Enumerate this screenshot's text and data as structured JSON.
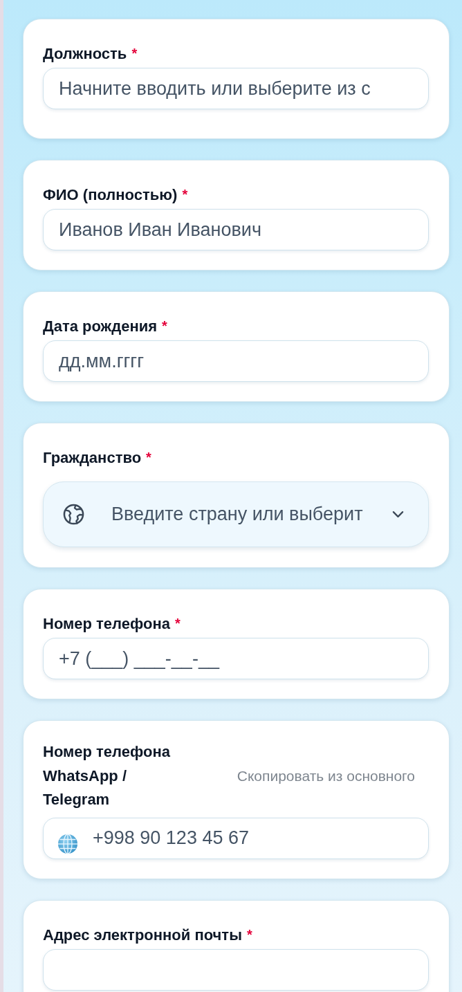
{
  "fields": [
    {
      "kind": "autocomplete",
      "label": "Должность",
      "required_mark": "*",
      "placeholder": "Начните вводить или выберите из с"
    },
    {
      "kind": "text",
      "label": "ФИО (полностью)",
      "required_mark": "*",
      "placeholder": "Иванов Иван Иванович"
    },
    {
      "kind": "date",
      "label": "Дата рождения",
      "required_mark": "*",
      "placeholder": "дд.мм.гггг"
    },
    {
      "kind": "select",
      "label": "Гражданство",
      "required_mark": "*",
      "placeholder": "Введите страну или выберит"
    },
    {
      "kind": "text",
      "label": "Номер телефона",
      "required_mark": "*",
      "placeholder": "+7 (___) ___-__-__"
    },
    {
      "kind": "phone",
      "label": "Номер телефона WhatsApp / Telegram",
      "action": "Скопировать из основного",
      "placeholder": "+998 90 123 45 67"
    },
    {
      "kind": "text",
      "label": "Адрес электронной почты",
      "required_mark": "*"
    }
  ]
}
